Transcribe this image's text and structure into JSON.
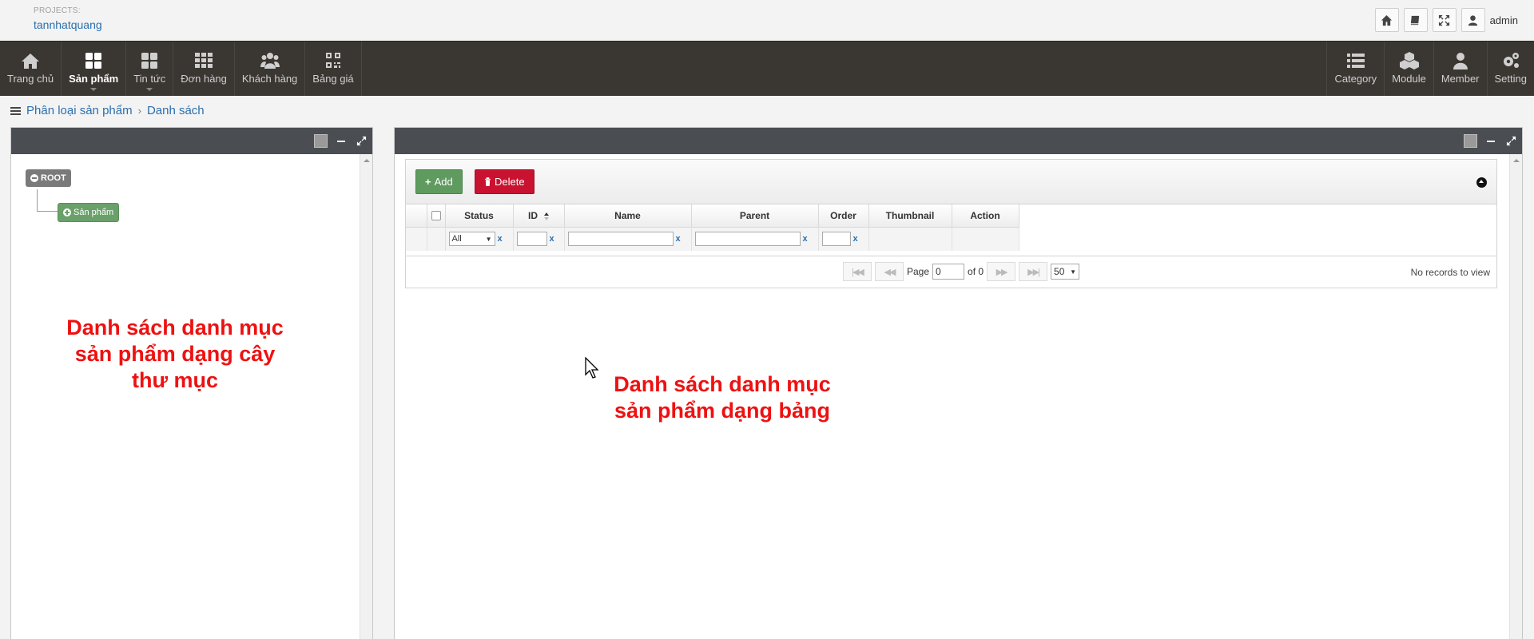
{
  "header": {
    "projects_label": "PROJECTS:",
    "project_name": "tannhatquang",
    "user_name": "admin",
    "icons": [
      "home-icon",
      "book-icon",
      "fullscreen-icon",
      "user-icon"
    ]
  },
  "nav": {
    "left": [
      {
        "label": "Trang chủ",
        "icon": "home-icon",
        "active": false,
        "caret": false
      },
      {
        "label": "Sản phẩm",
        "icon": "grid-4-icon",
        "active": true,
        "caret": true
      },
      {
        "label": "Tin tức",
        "icon": "grid-4-icon",
        "active": false,
        "caret": true
      },
      {
        "label": "Đơn hàng",
        "icon": "grid-9-icon",
        "active": false,
        "caret": false
      },
      {
        "label": "Khách hàng",
        "icon": "users-icon",
        "active": false,
        "caret": false
      },
      {
        "label": "Bảng giá",
        "icon": "qr-icon",
        "active": false,
        "caret": false
      }
    ],
    "right": [
      {
        "label": "Category",
        "icon": "list-icon"
      },
      {
        "label": "Module",
        "icon": "cubes-icon"
      },
      {
        "label": "Member",
        "icon": "user-icon"
      },
      {
        "label": "Setting",
        "icon": "gears-icon"
      }
    ]
  },
  "breadcrumb": {
    "item1": "Phân loại sản phẩm",
    "separator": "›",
    "item2": "Danh sách"
  },
  "tree": {
    "root_label": "ROOT",
    "child_label": "Sản phẩm"
  },
  "annotations": {
    "left": [
      "Danh sách danh mục",
      "sản phẩm dạng cây",
      "thư mục"
    ],
    "right": [
      "Danh sách danh mục",
      "sản phẩm dạng bảng"
    ],
    "color": "#ee1111"
  },
  "grid": {
    "add_label": "Add",
    "delete_label": "Delete",
    "columns": [
      "Status",
      "ID",
      "Name",
      "Parent",
      "Order",
      "Thumbnail",
      "Action"
    ],
    "status_filter": "All",
    "clear_label": "x",
    "pager": {
      "page_label": "Page",
      "page_value": "0",
      "of_label": "of 0",
      "page_size": "50",
      "info": "No records to view"
    }
  },
  "colors": {
    "navbar": "#3a3632",
    "panel_head": "#4a4d52",
    "add_button": "#5f9a5f",
    "delete_button": "#c9122f",
    "link": "#2a6fb0"
  }
}
